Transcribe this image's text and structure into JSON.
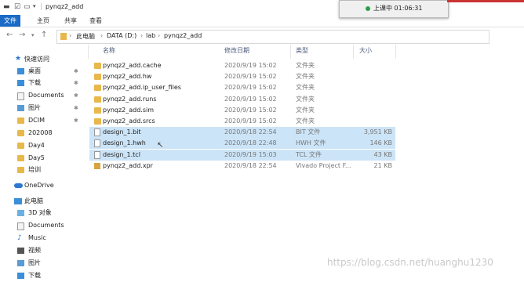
{
  "window": {
    "title": "pynqz2_add"
  },
  "recorder": {
    "status": "上课中 01:06:31"
  },
  "ribbon": {
    "tabs": [
      "文件",
      "主页",
      "共享",
      "查看"
    ]
  },
  "address": {
    "parts": [
      "此电脑",
      "DATA (D:)",
      "lab",
      "pynqz2_add"
    ]
  },
  "sidebar": {
    "items": [
      {
        "label": "快速访问",
        "pinned": false
      },
      {
        "label": "桌面",
        "pinned": true
      },
      {
        "label": "下载",
        "pinned": true
      },
      {
        "label": "Documents",
        "pinned": true
      },
      {
        "label": "图片",
        "pinned": true
      },
      {
        "label": "DCIM",
        "pinned": true
      },
      {
        "label": "202008",
        "pinned": false
      },
      {
        "label": "Day4",
        "pinned": false
      },
      {
        "label": "Day5",
        "pinned": false
      },
      {
        "label": "培训",
        "pinned": false
      },
      {
        "label": "OneDrive",
        "pinned": false
      },
      {
        "label": "此电脑",
        "pinned": false
      },
      {
        "label": "3D 对象",
        "pinned": false
      },
      {
        "label": "Documents",
        "pinned": false
      },
      {
        "label": "Music",
        "pinned": false
      },
      {
        "label": "视频",
        "pinned": false
      },
      {
        "label": "图片",
        "pinned": false
      },
      {
        "label": "下载",
        "pinned": false
      }
    ]
  },
  "columns": {
    "name": "名称",
    "date": "修改日期",
    "type": "类型",
    "size": "大小"
  },
  "files": [
    {
      "name": "pynqz2_add.cache",
      "date": "2020/9/19 15:02",
      "type": "文件夹",
      "size": "",
      "kind": "folder",
      "selected": false
    },
    {
      "name": "pynqz2_add.hw",
      "date": "2020/9/19 15:02",
      "type": "文件夹",
      "size": "",
      "kind": "folder",
      "selected": false
    },
    {
      "name": "pynqz2_add.ip_user_files",
      "date": "2020/9/19 15:02",
      "type": "文件夹",
      "size": "",
      "kind": "folder",
      "selected": false
    },
    {
      "name": "pynqz2_add.runs",
      "date": "2020/9/19 15:02",
      "type": "文件夹",
      "size": "",
      "kind": "folder",
      "selected": false
    },
    {
      "name": "pynqz2_add.sim",
      "date": "2020/9/19 15:02",
      "type": "文件夹",
      "size": "",
      "kind": "folder",
      "selected": false
    },
    {
      "name": "pynqz2_add.srcs",
      "date": "2020/9/19 15:02",
      "type": "文件夹",
      "size": "",
      "kind": "folder",
      "selected": false
    },
    {
      "name": "design_1.bit",
      "date": "2020/9/18 22:54",
      "type": "BIT 文件",
      "size": "3,951 KB",
      "kind": "file",
      "selected": true
    },
    {
      "name": "design_1.hwh",
      "date": "2020/9/18 22:48",
      "type": "HWH 文件",
      "size": "146 KB",
      "kind": "file",
      "selected": true
    },
    {
      "name": "design_1.tcl",
      "date": "2020/9/19 15:03",
      "type": "TCL 文件",
      "size": "43 KB",
      "kind": "file",
      "selected": true
    },
    {
      "name": "pynqz2_add.xpr",
      "date": "2020/9/18 22:54",
      "type": "Vivado Project F...",
      "size": "21 KB",
      "kind": "xpr",
      "selected": false
    }
  ],
  "watermark": "https://blog.csdn.net/huanghu1230",
  "colors": {
    "accent": "#1a6ac6",
    "selection": "#cce4f7",
    "folder": "#e8b84a"
  }
}
